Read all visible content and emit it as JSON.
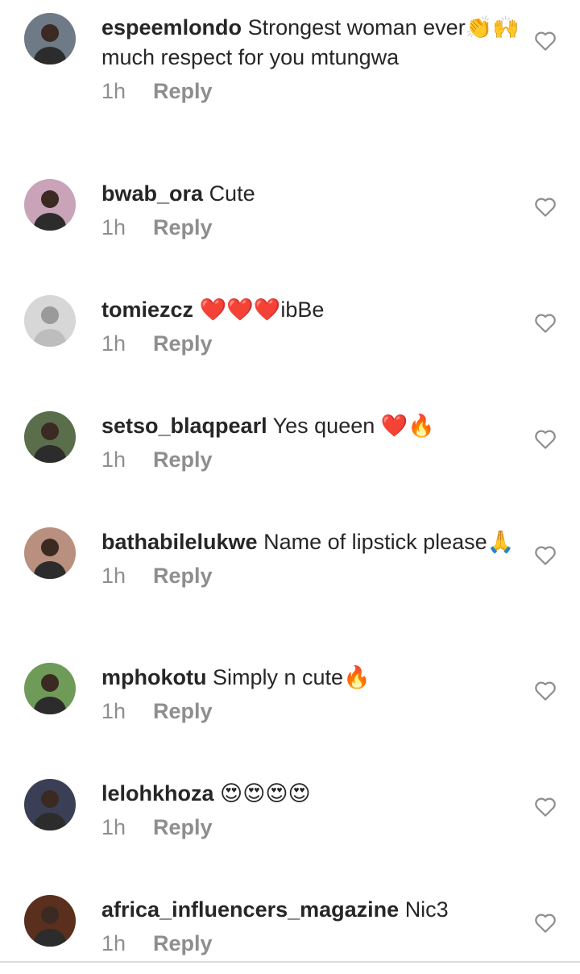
{
  "comments": [
    {
      "username": "espeemlondo",
      "text": "Strongest woman ever👏🙌 much respect for you mtungwa",
      "time": "1h",
      "reply": "Reply",
      "avatar_color": "#6e7a86"
    },
    {
      "username": "bwab_ora",
      "text": "Cute",
      "time": "1h",
      "reply": "Reply",
      "avatar_color": "#c9a3b8"
    },
    {
      "username": "tomiezcz",
      "text": "❤️❤️❤️ibBe",
      "time": "1h",
      "reply": "Reply",
      "avatar_color": "#d7d7d7"
    },
    {
      "username": "setso_blaqpearl",
      "text": "Yes queen ❤️🔥",
      "time": "1h",
      "reply": "Reply",
      "avatar_color": "#5b6e4b"
    },
    {
      "username": "bathabilelukwe",
      "text": "Name of lipstick please🙏",
      "time": "1h",
      "reply": "Reply",
      "avatar_color": "#b98f7f"
    },
    {
      "username": "mphokotu",
      "text": "Simply n cute🔥",
      "time": "1h",
      "reply": "Reply",
      "avatar_color": "#6f9b58"
    },
    {
      "username": "lelohkhoza",
      "text": "😍😍😍😍",
      "time": "1h",
      "reply": "Reply",
      "avatar_color": "#3a3f55"
    },
    {
      "username": "africa_influencers_magazine",
      "text": "Nic3",
      "time": "1h",
      "reply": "Reply",
      "avatar_color": "#5a2f1e"
    }
  ],
  "icons": {
    "like": "heart-outline-icon"
  }
}
